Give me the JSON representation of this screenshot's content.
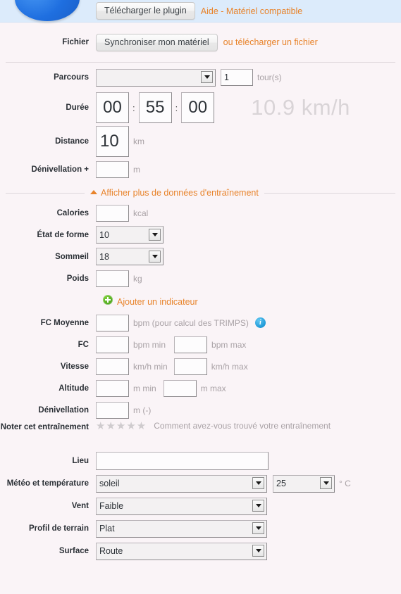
{
  "topbar": {
    "plugin_button": "Télécharger le plugin",
    "help_link": "Aide - Matériel compatible",
    "logo_name": "blue-circle-logo"
  },
  "file_row": {
    "label": "Fichier",
    "sync_button": "Synchroniser mon matériel",
    "upload_link": "ou télécharger un fichier"
  },
  "fields": {
    "parcours": {
      "label": "Parcours",
      "value": "",
      "laps_value": "1",
      "laps_unit": "tour(s)"
    },
    "duree": {
      "label": "Durée",
      "hours": "00",
      "minutes": "55",
      "seconds": "00",
      "separator": ":",
      "speed": "10.9 km/h"
    },
    "distance": {
      "label": "Distance",
      "value": "10",
      "unit": "km"
    },
    "denivellation_plus": {
      "label": "Dénivellation +",
      "value": "",
      "unit": "m"
    },
    "calories": {
      "label": "Calories",
      "value": "",
      "unit": "kcal"
    },
    "etat_de_forme": {
      "label": "État de forme",
      "value": "10"
    },
    "sommeil": {
      "label": "Sommeil",
      "value": "18"
    },
    "poids": {
      "label": "Poids",
      "value": "",
      "unit": "kg"
    },
    "fc_moyenne": {
      "label": "FC Moyenne",
      "value": "",
      "unit": "bpm (pour calcul des TRIMPS)"
    },
    "fc": {
      "label": "FC",
      "min_value": "",
      "min_unit": "bpm min",
      "max_value": "",
      "max_unit": "bpm max"
    },
    "vitesse": {
      "label": "Vitesse",
      "min_value": "",
      "min_unit": "km/h min",
      "max_value": "",
      "max_unit": "km/h max"
    },
    "altitude": {
      "label": "Altitude",
      "min_value": "",
      "min_unit": "m min",
      "max_value": "",
      "max_unit": "m max"
    },
    "denivellation_moins": {
      "label": "Dénivellation",
      "value": "",
      "unit": "m (-)"
    },
    "noter": {
      "label": "Noter cet entraînement",
      "stars": "★★★★★",
      "hint": "Comment avez-vous trouvé votre entraînement"
    },
    "lieu": {
      "label": "Lieu",
      "value": ""
    },
    "meteo": {
      "label": "Météo et température",
      "value": "soleil",
      "temp_value": "25",
      "temp_unit": "° C"
    },
    "vent": {
      "label": "Vent",
      "value": "Faible"
    },
    "profil": {
      "label": "Profil de terrain",
      "value": "Plat"
    },
    "surface": {
      "label": "Surface",
      "value": "Route"
    }
  },
  "toggle": {
    "label": "Afficher plus de données d'entraînement",
    "caret": "up"
  },
  "add_indicator": {
    "label": "Ajouter un indicateur"
  },
  "colors": {
    "accent_orange": "#e8842c",
    "band_blue": "#dcebfb",
    "page_bg": "#faf4f7",
    "muted": "#a9a2a6"
  }
}
